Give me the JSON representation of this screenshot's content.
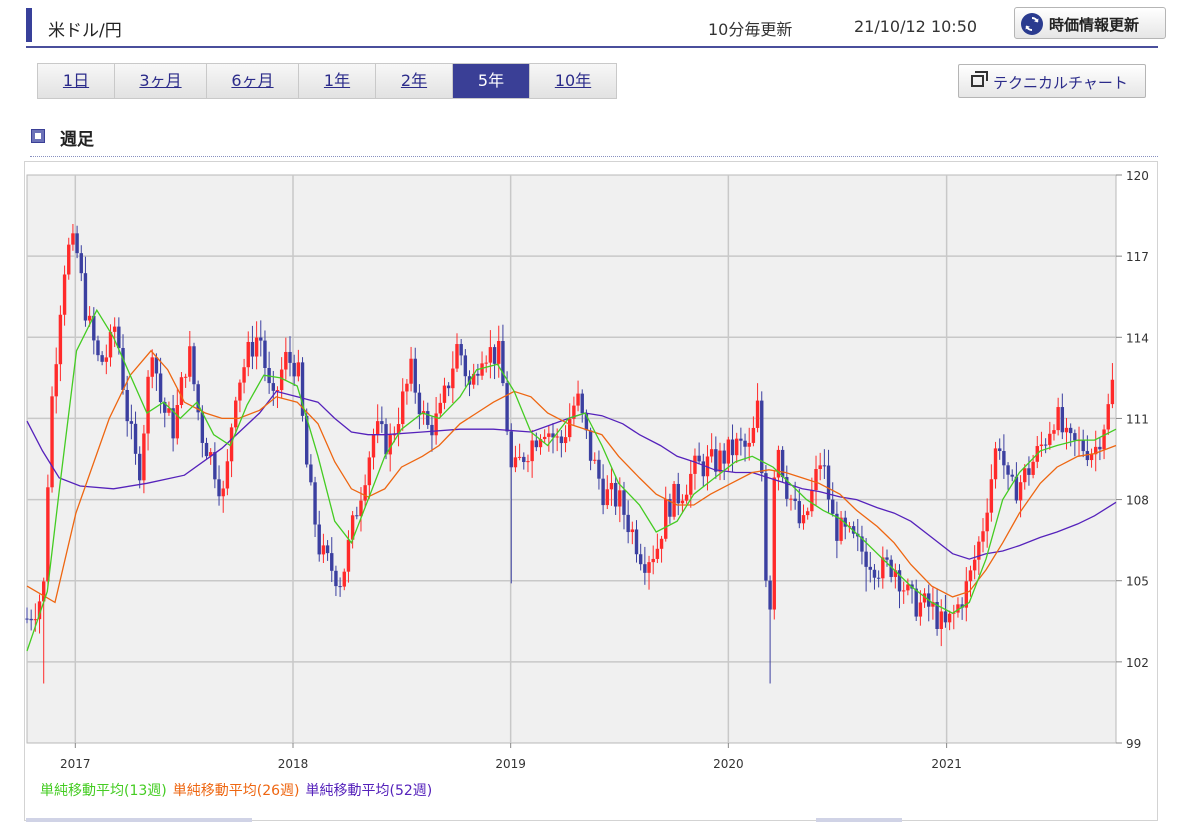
{
  "header": {
    "title": "米ドル/円",
    "update_freq": "10分毎更新",
    "timestamp": "21/10/12 10:50",
    "refresh_label": "時価情報更新"
  },
  "period_tabs": [
    {
      "label": "1日",
      "active": false
    },
    {
      "label": "3ヶ月",
      "active": false
    },
    {
      "label": "6ヶ月",
      "active": false
    },
    {
      "label": "1年",
      "active": false
    },
    {
      "label": "2年",
      "active": false
    },
    {
      "label": "5年",
      "active": true
    },
    {
      "label": "10年",
      "active": false
    }
  ],
  "technical_chart_label": "テクニカルチャート",
  "section_label": "週足",
  "colors": {
    "accent": "#3a3f96",
    "up": "#ff2a2a",
    "down": "#3b3fa0",
    "ma13": "#44cc22",
    "ma26": "#ee6611",
    "ma52": "#5522bb",
    "plot_bg": "#f0f0f0"
  },
  "chart_data": {
    "type": "candlestick",
    "y_ticks": [
      "120",
      "117",
      "114",
      "111",
      "108",
      "105",
      "102",
      "99"
    ],
    "ylim": [
      99,
      120
    ],
    "x_ticks": [
      "2017",
      "2018",
      "2019",
      "2020",
      "2021"
    ],
    "x_tick_dates": [
      "2017-01-01",
      "2018-01-01",
      "2019-01-01",
      "2020-01-01",
      "2021-01-01"
    ],
    "date_range": [
      "2016-10-12",
      "2021-10-12"
    ],
    "grid": true,
    "legend": [
      {
        "name": "単純移動平均(13週)",
        "color": "#44cc22"
      },
      {
        "name": "単純移動平均(26週)",
        "color": "#ee6611"
      },
      {
        "name": "単純移動平均(52週)",
        "color": "#5522bb"
      }
    ],
    "anchors": [
      [
        "2016-10-12",
        103.6
      ],
      [
        "2016-10-31",
        104.2
      ],
      [
        "2016-11-09",
        104.8
      ],
      [
        "2016-11-20",
        111.0
      ],
      [
        "2016-12-12",
        116.5
      ],
      [
        "2016-12-23",
        117.4
      ],
      [
        "2017-01-03",
        117.2
      ],
      [
        "2017-01-20",
        114.8
      ],
      [
        "2017-02-10",
        113.0
      ],
      [
        "2017-02-27",
        113.5
      ],
      [
        "2017-03-10",
        114.6
      ],
      [
        "2017-03-27",
        111.4
      ],
      [
        "2017-04-17",
        108.8
      ],
      [
        "2017-05-10",
        113.8
      ],
      [
        "2017-05-25",
        111.5
      ],
      [
        "2017-06-15",
        110.6
      ],
      [
        "2017-07-10",
        113.6
      ],
      [
        "2017-07-31",
        110.5
      ],
      [
        "2017-08-20",
        109.4
      ],
      [
        "2017-09-08",
        108.0
      ],
      [
        "2017-09-25",
        112.0
      ],
      [
        "2017-10-20",
        113.5
      ],
      [
        "2017-11-06",
        114.2
      ],
      [
        "2017-11-27",
        111.3
      ],
      [
        "2017-12-18",
        113.2
      ],
      [
        "2018-01-08",
        113.0
      ],
      [
        "2018-01-26",
        108.8
      ],
      [
        "2018-02-16",
        106.0
      ],
      [
        "2018-03-23",
        105.0
      ],
      [
        "2018-04-16",
        107.5
      ],
      [
        "2018-05-18",
        110.6
      ],
      [
        "2018-06-11",
        110.0
      ],
      [
        "2018-07-18",
        112.7
      ],
      [
        "2018-08-13",
        110.6
      ],
      [
        "2018-09-03",
        111.0
      ],
      [
        "2018-10-05",
        113.8
      ],
      [
        "2018-10-26",
        112.0
      ],
      [
        "2018-11-12",
        113.6
      ],
      [
        "2018-12-14",
        113.3
      ],
      [
        "2018-12-28",
        110.3
      ],
      [
        "2019-01-03",
        108.8
      ],
      [
        "2019-01-21",
        109.6
      ],
      [
        "2019-02-25",
        110.8
      ],
      [
        "2019-03-25",
        110.0
      ],
      [
        "2019-04-22",
        111.8
      ],
      [
        "2019-05-13",
        109.8
      ],
      [
        "2019-06-07",
        108.2
      ],
      [
        "2019-07-01",
        108.0
      ],
      [
        "2019-08-12",
        105.8
      ],
      [
        "2019-09-03",
        106.2
      ],
      [
        "2019-09-20",
        107.8
      ],
      [
        "2019-10-11",
        108.2
      ],
      [
        "2019-11-08",
        109.2
      ],
      [
        "2019-12-13",
        109.4
      ],
      [
        "2020-01-17",
        110.0
      ],
      [
        "2020-02-07",
        109.8
      ],
      [
        "2020-02-21",
        111.6
      ],
      [
        "2020-03-09",
        102.8
      ],
      [
        "2020-03-20",
        110.6
      ],
      [
        "2020-04-06",
        108.6
      ],
      [
        "2020-05-04",
        106.8
      ],
      [
        "2020-06-05",
        109.6
      ],
      [
        "2020-06-26",
        107.0
      ],
      [
        "2020-07-20",
        106.6
      ],
      [
        "2020-08-17",
        106.0
      ],
      [
        "2020-09-14",
        105.4
      ],
      [
        "2020-10-05",
        105.6
      ],
      [
        "2020-11-02",
        104.2
      ],
      [
        "2020-12-07",
        104.0
      ],
      [
        "2020-12-28",
        103.2
      ],
      [
        "2021-01-15",
        103.8
      ],
      [
        "2021-02-08",
        105.0
      ],
      [
        "2021-03-01",
        106.8
      ],
      [
        "2021-03-29",
        110.4
      ],
      [
        "2021-04-16",
        108.2
      ],
      [
        "2021-05-10",
        108.8
      ],
      [
        "2021-05-31",
        109.6
      ],
      [
        "2021-06-14",
        110.2
      ],
      [
        "2021-07-02",
        111.2
      ],
      [
        "2021-07-23",
        110.0
      ],
      [
        "2021-08-13",
        110.0
      ],
      [
        "2021-09-06",
        109.8
      ],
      [
        "2021-09-24",
        111.0
      ],
      [
        "2021-10-01",
        111.5
      ],
      [
        "2021-10-12",
        113.2
      ]
    ],
    "ma13": [
      [
        "2016-10-12",
        102.4
      ],
      [
        "2016-11-15",
        104.6
      ],
      [
        "2016-12-06",
        108.5
      ],
      [
        "2017-01-03",
        113.5
      ],
      [
        "2017-02-06",
        115.0
      ],
      [
        "2017-03-06",
        114.0
      ],
      [
        "2017-04-03",
        112.6
      ],
      [
        "2017-05-01",
        111.2
      ],
      [
        "2017-05-29",
        111.6
      ],
      [
        "2017-06-26",
        111.0
      ],
      [
        "2017-07-24",
        111.6
      ],
      [
        "2017-08-21",
        110.4
      ],
      [
        "2017-09-18",
        110.0
      ],
      [
        "2017-10-16",
        111.5
      ],
      [
        "2017-11-13",
        112.6
      ],
      [
        "2017-12-11",
        112.5
      ],
      [
        "2018-01-08",
        112.2
      ],
      [
        "2018-02-12",
        109.6
      ],
      [
        "2018-03-12",
        107.2
      ],
      [
        "2018-04-09",
        106.4
      ],
      [
        "2018-05-07",
        108.0
      ],
      [
        "2018-06-04",
        109.6
      ],
      [
        "2018-07-02",
        110.6
      ],
      [
        "2018-08-06",
        111.2
      ],
      [
        "2018-09-03",
        111.0
      ],
      [
        "2018-10-08",
        111.8
      ],
      [
        "2018-11-05",
        112.8
      ],
      [
        "2018-12-10",
        113.0
      ],
      [
        "2019-01-07",
        112.0
      ],
      [
        "2019-02-04",
        110.5
      ],
      [
        "2019-03-04",
        110.0
      ],
      [
        "2019-04-08",
        111.0
      ],
      [
        "2019-05-06",
        111.2
      ],
      [
        "2019-06-03",
        110.0
      ],
      [
        "2019-07-01",
        108.6
      ],
      [
        "2019-08-05",
        107.8
      ],
      [
        "2019-09-02",
        106.8
      ],
      [
        "2019-10-07",
        107.2
      ],
      [
        "2019-11-04",
        108.2
      ],
      [
        "2019-12-09",
        108.8
      ],
      [
        "2020-01-13",
        109.4
      ],
      [
        "2020-02-10",
        109.6
      ],
      [
        "2020-03-16",
        109.2
      ],
      [
        "2020-04-13",
        108.6
      ],
      [
        "2020-05-11",
        108.0
      ],
      [
        "2020-06-08",
        107.6
      ],
      [
        "2020-07-06",
        107.3
      ],
      [
        "2020-08-10",
        106.6
      ],
      [
        "2020-09-07",
        106.0
      ],
      [
        "2020-10-05",
        105.4
      ],
      [
        "2020-11-02",
        104.8
      ],
      [
        "2020-12-07",
        104.2
      ],
      [
        "2021-01-11",
        103.8
      ],
      [
        "2021-02-08",
        104.2
      ],
      [
        "2021-03-08",
        105.8
      ],
      [
        "2021-04-05",
        108.0
      ],
      [
        "2021-05-03",
        109.0
      ],
      [
        "2021-06-07",
        109.8
      ],
      [
        "2021-07-05",
        110.0
      ],
      [
        "2021-08-09",
        110.2
      ],
      [
        "2021-09-06",
        110.2
      ],
      [
        "2021-10-12",
        110.6
      ]
    ],
    "ma26": [
      [
        "2016-10-12",
        104.8
      ],
      [
        "2016-11-28",
        104.2
      ],
      [
        "2017-01-02",
        107.5
      ],
      [
        "2017-02-27",
        111.0
      ],
      [
        "2017-04-03",
        112.6
      ],
      [
        "2017-05-08",
        113.5
      ],
      [
        "2017-06-05",
        112.8
      ],
      [
        "2017-07-03",
        111.6
      ],
      [
        "2017-08-07",
        111.2
      ],
      [
        "2017-09-04",
        111.0
      ],
      [
        "2017-10-02",
        111.0
      ],
      [
        "2017-11-06",
        111.3
      ],
      [
        "2017-12-04",
        111.8
      ],
      [
        "2018-01-08",
        111.6
      ],
      [
        "2018-02-12",
        110.8
      ],
      [
        "2018-03-12",
        109.4
      ],
      [
        "2018-04-09",
        108.4
      ],
      [
        "2018-05-07",
        108.1
      ],
      [
        "2018-06-04",
        108.4
      ],
      [
        "2018-07-02",
        109.2
      ],
      [
        "2018-08-06",
        109.6
      ],
      [
        "2018-09-03",
        110.0
      ],
      [
        "2018-10-08",
        110.8
      ],
      [
        "2018-11-05",
        111.2
      ],
      [
        "2018-12-03",
        111.6
      ],
      [
        "2019-01-07",
        112.0
      ],
      [
        "2019-02-04",
        111.8
      ],
      [
        "2019-03-04",
        111.2
      ],
      [
        "2019-04-08",
        110.8
      ],
      [
        "2019-05-06",
        110.6
      ],
      [
        "2019-06-03",
        110.4
      ],
      [
        "2019-07-01",
        109.6
      ],
      [
        "2019-08-05",
        108.8
      ],
      [
        "2019-09-02",
        108.2
      ],
      [
        "2019-10-07",
        107.8
      ],
      [
        "2019-11-04",
        107.8
      ],
      [
        "2019-12-02",
        108.2
      ],
      [
        "2020-01-06",
        108.6
      ],
      [
        "2020-02-10",
        109.0
      ],
      [
        "2020-03-09",
        109.1
      ],
      [
        "2020-04-06",
        109.0
      ],
      [
        "2020-05-04",
        108.8
      ],
      [
        "2020-06-01",
        108.6
      ],
      [
        "2020-07-06",
        108.2
      ],
      [
        "2020-08-03",
        107.6
      ],
      [
        "2020-09-07",
        107.0
      ],
      [
        "2020-10-05",
        106.4
      ],
      [
        "2020-11-02",
        105.6
      ],
      [
        "2020-12-07",
        104.8
      ],
      [
        "2021-01-11",
        104.4
      ],
      [
        "2021-02-08",
        104.6
      ],
      [
        "2021-03-08",
        105.4
      ],
      [
        "2021-04-05",
        106.4
      ],
      [
        "2021-05-03",
        107.5
      ],
      [
        "2021-06-07",
        108.6
      ],
      [
        "2021-07-05",
        109.2
      ],
      [
        "2021-08-09",
        109.6
      ],
      [
        "2021-09-06",
        109.7
      ],
      [
        "2021-10-12",
        110.0
      ]
    ],
    "ma52": [
      [
        "2016-10-12",
        110.9
      ],
      [
        "2016-11-07",
        109.8
      ],
      [
        "2016-12-05",
        108.8
      ],
      [
        "2017-01-09",
        108.5
      ],
      [
        "2017-03-06",
        108.4
      ],
      [
        "2017-05-01",
        108.6
      ],
      [
        "2017-07-03",
        108.9
      ],
      [
        "2017-09-04",
        109.9
      ],
      [
        "2017-11-06",
        111.2
      ],
      [
        "2017-12-04",
        112.0
      ],
      [
        "2018-01-08",
        111.8
      ],
      [
        "2018-02-12",
        111.6
      ],
      [
        "2018-03-12",
        111.0
      ],
      [
        "2018-04-09",
        110.5
      ],
      [
        "2018-05-07",
        110.4
      ],
      [
        "2018-06-04",
        110.4
      ],
      [
        "2018-08-06",
        110.5
      ],
      [
        "2018-10-08",
        110.6
      ],
      [
        "2018-12-03",
        110.6
      ],
      [
        "2019-02-04",
        110.5
      ],
      [
        "2019-04-08",
        111.0
      ],
      [
        "2019-05-06",
        111.2
      ],
      [
        "2019-06-03",
        111.1
      ],
      [
        "2019-07-08",
        110.8
      ],
      [
        "2019-08-05",
        110.4
      ],
      [
        "2019-09-09",
        110.0
      ],
      [
        "2019-10-07",
        109.6
      ],
      [
        "2019-11-04",
        109.4
      ],
      [
        "2019-12-09",
        109.1
      ],
      [
        "2020-01-13",
        109.0
      ],
      [
        "2020-02-10",
        109.0
      ],
      [
        "2020-03-09",
        108.8
      ],
      [
        "2020-04-06",
        108.6
      ],
      [
        "2020-05-04",
        108.4
      ],
      [
        "2020-06-01",
        108.3
      ],
      [
        "2020-07-06",
        108.1
      ],
      [
        "2020-08-03",
        108.0
      ],
      [
        "2020-09-07",
        107.7
      ],
      [
        "2020-10-05",
        107.5
      ],
      [
        "2020-11-02",
        107.2
      ],
      [
        "2020-12-07",
        106.6
      ],
      [
        "2021-01-11",
        106.0
      ],
      [
        "2021-02-08",
        105.8
      ],
      [
        "2021-03-08",
        106.0
      ],
      [
        "2021-04-05",
        106.1
      ],
      [
        "2021-05-03",
        106.3
      ],
      [
        "2021-06-07",
        106.6
      ],
      [
        "2021-07-05",
        106.8
      ],
      [
        "2021-08-09",
        107.1
      ],
      [
        "2021-09-06",
        107.4
      ],
      [
        "2021-10-12",
        107.9
      ]
    ]
  }
}
